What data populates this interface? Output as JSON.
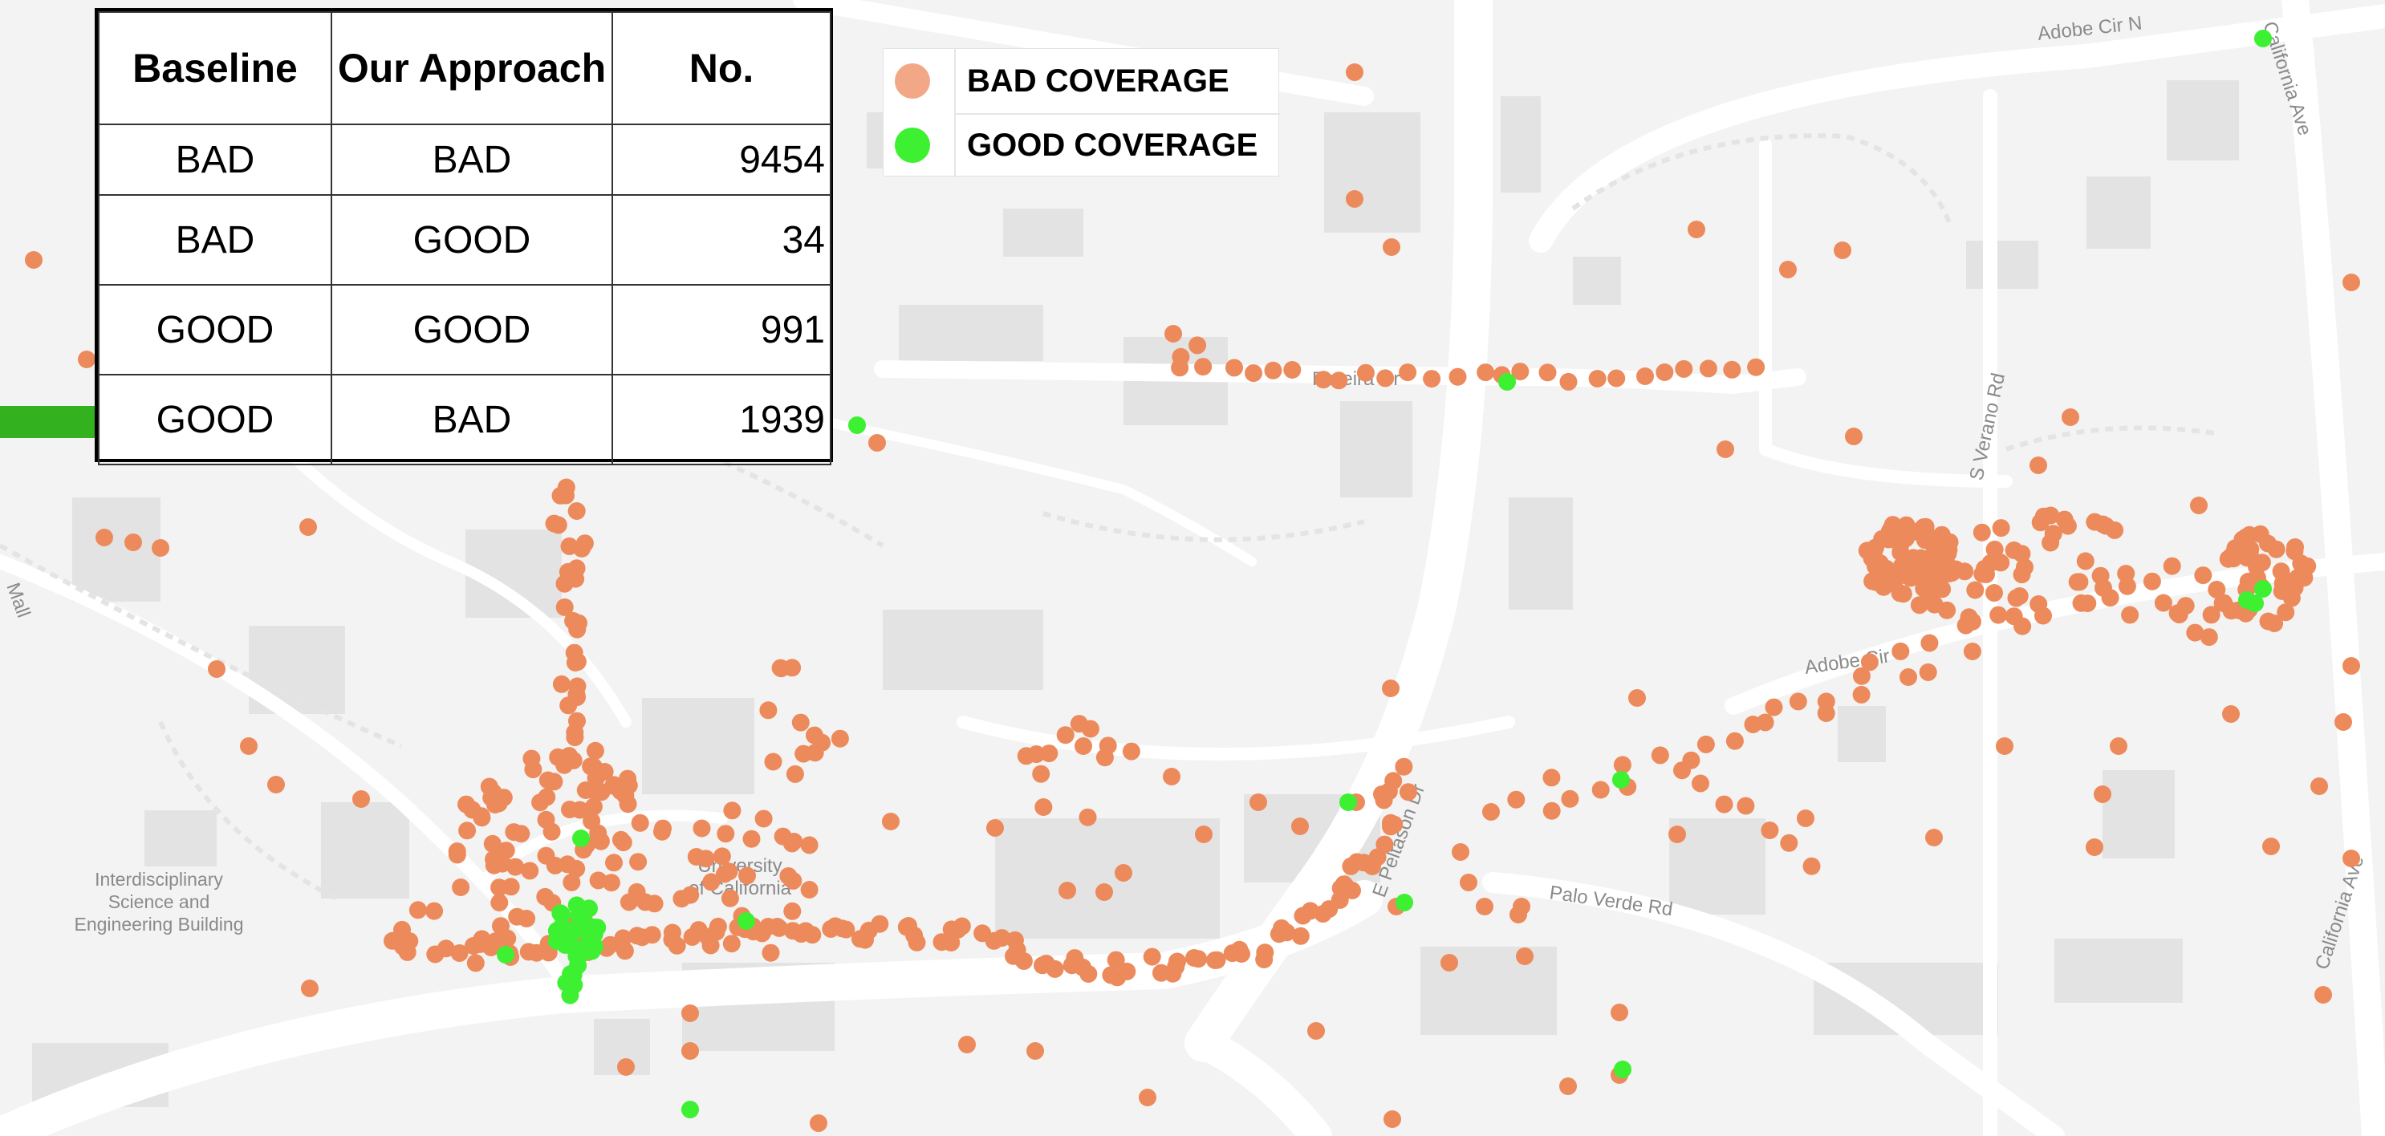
{
  "colors": {
    "bad": "#ec8a5c",
    "bad_legend": "#f2a887",
    "good": "#3ef032",
    "arrow": "#33b11f",
    "road": "#ffffff",
    "building": "#e2e2e2",
    "background": "#f3f3f3"
  },
  "table": {
    "headers": [
      "Baseline",
      "Our Approach",
      "No."
    ],
    "rows": [
      {
        "baseline": "BAD",
        "approach": "BAD",
        "count": "9454"
      },
      {
        "baseline": "BAD",
        "approach": "GOOD",
        "count": "34"
      },
      {
        "baseline": "GOOD",
        "approach": "GOOD",
        "count": "991"
      },
      {
        "baseline": "GOOD",
        "approach": "BAD",
        "count": "1939"
      }
    ]
  },
  "legend": {
    "items": [
      {
        "label": "BAD COVERAGE",
        "color": "#f2a887"
      },
      {
        "label": "GOOD COVERAGE",
        "color": "#3ef032"
      }
    ]
  },
  "arrow": {
    "icon": "right-arrow-icon"
  },
  "map_labels": {
    "adobe_cir_n": "Adobe Cir N",
    "california_ave_top": "California Ave",
    "california_ave_bottom": "California Ave",
    "s_verano_rd": "S Verano Rd",
    "pereira_dr": "Pereira Dr",
    "adobe_cir": "Adobe Cir",
    "e_peltason_dr": "E Peltason Dr",
    "palo_verde_rd": "Palo Verde Rd",
    "university": "University",
    "of_california": "of California",
    "isb_1": "Interdisciplinary",
    "isb_2": "Science and",
    "isb_3": "Engineering Building",
    "mall": "Mall"
  }
}
